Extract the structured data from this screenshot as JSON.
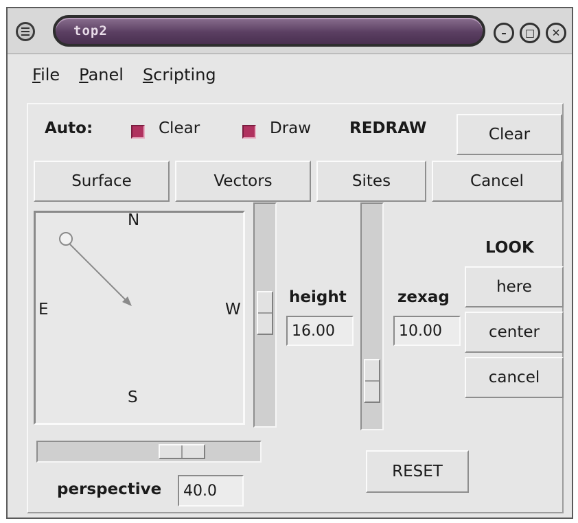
{
  "window": {
    "title": "top2"
  },
  "menubar": {
    "items": [
      {
        "accel": "F",
        "rest": "ile"
      },
      {
        "accel": "P",
        "rest": "anel"
      },
      {
        "accel": "S",
        "rest": "cripting"
      }
    ]
  },
  "auto_row": {
    "auto_label": "Auto:",
    "clear_check_label": "Clear",
    "draw_check_label": "Draw",
    "redraw_label": "REDRAW",
    "clear_button": "Clear"
  },
  "draw_buttons": {
    "surface": "Surface",
    "vectors": "Vectors",
    "sites": "Sites",
    "cancel": "Cancel"
  },
  "compass": {
    "n": "N",
    "e": "E",
    "w": "W",
    "s": "S"
  },
  "height": {
    "label": "height",
    "value": "16.00"
  },
  "zexag": {
    "label": "zexag",
    "value": "10.00"
  },
  "look": {
    "label": "LOOK",
    "here": "here",
    "center": "center",
    "cancel": "cancel"
  },
  "perspective": {
    "label": "perspective",
    "value": "40.0"
  },
  "reset_label": "RESET",
  "colors": {
    "title_bar": "#5b3f62",
    "checkbox_on": "#b0325f",
    "panel_bg": "#e6e6e6"
  },
  "icons": [
    "window-menu-icon",
    "minimize-icon",
    "maximize-icon",
    "close-icon",
    "position-handle-icon",
    "direction-arrow-icon"
  ]
}
